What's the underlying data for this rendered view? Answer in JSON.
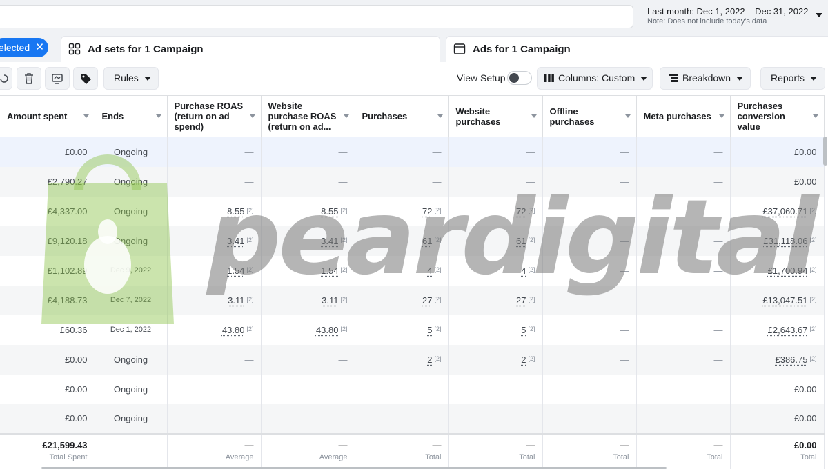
{
  "date_range": {
    "label": "Last month: Dec 1, 2022 – Dec 31, 2022",
    "note": "Note: Does not include today's data"
  },
  "tabs": {
    "selected_label": "elected",
    "adsets_label": "Ad sets for 1 Campaign",
    "ads_label": "Ads for 1 Campaign"
  },
  "toolbar": {
    "rules": "Rules",
    "view_setup": "View Setup",
    "columns": "Columns: Custom",
    "breakdown": "Breakdown",
    "reports": "Reports"
  },
  "columns": [
    "Amount spent",
    "Ends",
    "Purchase ROAS (return on ad spend)",
    "Website purchase ROAS (return on ad...",
    "Purchases",
    "Website purchases",
    "Offline purchases",
    "Meta purchases",
    "Purchases conversion value"
  ],
  "rows": [
    {
      "amount": "£0.00",
      "ends": "Ongoing",
      "roas": "—",
      "web_roas": "—",
      "purchases": "—",
      "web_purchases": "—",
      "offline": "—",
      "meta": "—",
      "conv_value": "£0.00"
    },
    {
      "amount": "£2,790.27",
      "ends": "Ongoing",
      "roas": "—",
      "web_roas": "—",
      "purchases": "—",
      "web_purchases": "—",
      "offline": "—",
      "meta": "—",
      "conv_value": "£0.00"
    },
    {
      "amount": "£4,337.00",
      "ends": "Ongoing",
      "roas": "8.55",
      "web_roas": "8.55",
      "purchases": "72",
      "web_purchases": "72",
      "offline": "—",
      "meta": "—",
      "conv_value": "£37,060.71"
    },
    {
      "amount": "£9,120.18",
      "ends": "Ongoing",
      "roas": "3.41",
      "web_roas": "3.41",
      "purchases": "61",
      "web_purchases": "61",
      "offline": "—",
      "meta": "—",
      "conv_value": "£31,118.06"
    },
    {
      "amount": "£1,102.89",
      "ends": "Dec 9, 2022",
      "roas": "1.54",
      "web_roas": "1.54",
      "purchases": "4",
      "web_purchases": "4",
      "offline": "—",
      "meta": "—",
      "conv_value": "£1,700.94"
    },
    {
      "amount": "£4,188.73",
      "ends": "Dec 7, 2022",
      "roas": "3.11",
      "web_roas": "3.11",
      "purchases": "27",
      "web_purchases": "27",
      "offline": "—",
      "meta": "—",
      "conv_value": "£13,047.51"
    },
    {
      "amount": "£60.36",
      "ends": "Dec 1, 2022",
      "roas": "43.80",
      "web_roas": "43.80",
      "purchases": "5",
      "web_purchases": "5",
      "offline": "—",
      "meta": "—",
      "conv_value": "£2,643.67"
    },
    {
      "amount": "£0.00",
      "ends": "Ongoing",
      "roas": "—",
      "web_roas": "—",
      "purchases": "2",
      "web_purchases": "2",
      "offline": "—",
      "meta": "—",
      "conv_value": "£386.75"
    },
    {
      "amount": "£0.00",
      "ends": "Ongoing",
      "roas": "—",
      "web_roas": "—",
      "purchases": "—",
      "web_purchases": "—",
      "offline": "—",
      "meta": "—",
      "conv_value": "£0.00"
    },
    {
      "amount": "£0.00",
      "ends": "Ongoing",
      "roas": "—",
      "web_roas": "—",
      "purchases": "—",
      "web_purchases": "—",
      "offline": "—",
      "meta": "—",
      "conv_value": "£0.00"
    }
  ],
  "footnote_marker": "[2]",
  "totals": {
    "amount": "£21,599.43",
    "amount_label": "Total Spent",
    "roas": "—",
    "roas_label": "Average",
    "web_roas": "—",
    "web_roas_label": "Average",
    "purchases": "—",
    "purchases_label": "Total",
    "web_purchases": "—",
    "web_purchases_label": "Total",
    "offline": "—",
    "offline_label": "Total",
    "meta": "—",
    "meta_label": "Total",
    "conv_value": "£0.00",
    "conv_value_label": "Total"
  },
  "watermark": {
    "text": "peardigital",
    "text_color": "#8a8a8a",
    "bag_color": "#8bc34a"
  },
  "colors": {
    "accent": "#1877f2",
    "selected_row": "#eef3fd",
    "stripe_row": "#f5f6f7"
  }
}
